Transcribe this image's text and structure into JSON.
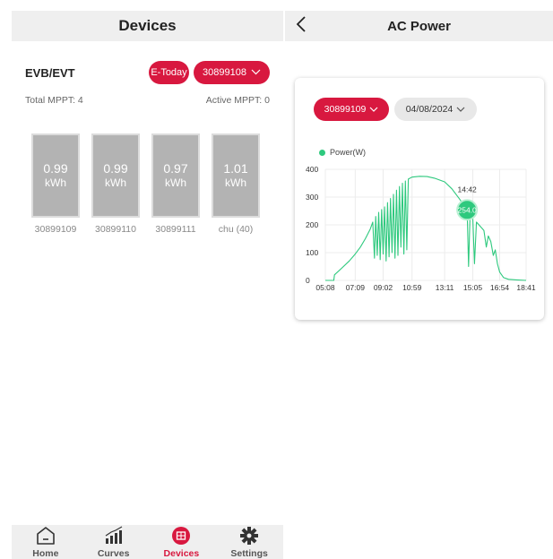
{
  "devices_screen": {
    "title": "Devices",
    "device_name": "EVB/EVT",
    "etoday_label": "E-Today",
    "selected_sn": "30899108",
    "total_mppt": "Total MPPT: 4",
    "active_mppt": "Active MPPT: 0",
    "cards": [
      {
        "value": "0.99",
        "unit": "kWh",
        "id": "30899109"
      },
      {
        "value": "0.99",
        "unit": "kWh",
        "id": "30899110"
      },
      {
        "value": "0.97",
        "unit": "kWh",
        "id": "30899111"
      },
      {
        "value": "1.01",
        "unit": "kWh",
        "id": "chu (40)"
      }
    ],
    "tabs": [
      {
        "label": "Home",
        "icon": "home-icon"
      },
      {
        "label": "Curves",
        "icon": "curves-icon"
      },
      {
        "label": "Devices",
        "icon": "devices-icon",
        "active": true
      },
      {
        "label": "Settings",
        "icon": "settings-icon"
      }
    ],
    "accent_color": "#d8183f"
  },
  "ac_power_screen": {
    "title": "AC Power",
    "selected_sn": "30899109",
    "selected_date": "04/08/2024",
    "tooltip": {
      "time": "14:42",
      "value": "254.0"
    },
    "chart_data": {
      "type": "line",
      "series": [
        {
          "name": "Power(W)",
          "color": "#2ec97e",
          "points": [
            [
              "05:08",
              0
            ],
            [
              "05:42",
              0
            ],
            [
              "05:45",
              20
            ],
            [
              "06:15",
              45
            ],
            [
              "06:45",
              70
            ],
            [
              "07:09",
              95
            ],
            [
              "07:30",
              120
            ],
            [
              "07:50",
              150
            ],
            [
              "08:10",
              185
            ],
            [
              "08:20",
              210
            ],
            [
              "08:27",
              80
            ],
            [
              "08:32",
              230
            ],
            [
              "08:38",
              90
            ],
            [
              "08:44",
              245
            ],
            [
              "08:50",
              75
            ],
            [
              "08:56",
              255
            ],
            [
              "09:02",
              95
            ],
            [
              "09:08",
              265
            ],
            [
              "09:14",
              70
            ],
            [
              "09:20",
              280
            ],
            [
              "09:26",
              85
            ],
            [
              "09:32",
              295
            ],
            [
              "09:38",
              100
            ],
            [
              "09:44",
              310
            ],
            [
              "09:50",
              80
            ],
            [
              "09:56",
              325
            ],
            [
              "10:02",
              90
            ],
            [
              "10:08",
              338
            ],
            [
              "10:14",
              120
            ],
            [
              "10:20",
              350
            ],
            [
              "10:26",
              95
            ],
            [
              "10:32",
              358
            ],
            [
              "10:38",
              110
            ],
            [
              "10:44",
              365
            ],
            [
              "10:59",
              372
            ],
            [
              "11:30",
              375
            ],
            [
              "12:00",
              374
            ],
            [
              "12:30",
              368
            ],
            [
              "13:11",
              355
            ],
            [
              "13:40",
              330
            ],
            [
              "14:10",
              295
            ],
            [
              "14:30",
              270
            ],
            [
              "14:42",
              254
            ],
            [
              "14:48",
              50
            ],
            [
              "14:54",
              240
            ],
            [
              "15:05",
              225
            ],
            [
              "15:12",
              60
            ],
            [
              "15:20",
              210
            ],
            [
              "15:35",
              195
            ],
            [
              "15:50",
              180
            ],
            [
              "16:00",
              120
            ],
            [
              "16:08",
              160
            ],
            [
              "16:18",
              140
            ],
            [
              "16:28",
              90
            ],
            [
              "16:36",
              110
            ],
            [
              "16:45",
              60
            ],
            [
              "16:54",
              30
            ],
            [
              "17:10",
              10
            ],
            [
              "17:30",
              4
            ],
            [
              "18:00",
              2
            ],
            [
              "18:41",
              0
            ]
          ]
        }
      ],
      "x_ticks": [
        "05:08",
        "07:09",
        "09:02",
        "10:59",
        "13:11",
        "15:05",
        "16:54",
        "18:41"
      ],
      "y_ticks": [
        0,
        100,
        200,
        300,
        400
      ],
      "ylim": [
        0,
        400
      ],
      "grid": true,
      "legend_position": "top-left"
    }
  }
}
